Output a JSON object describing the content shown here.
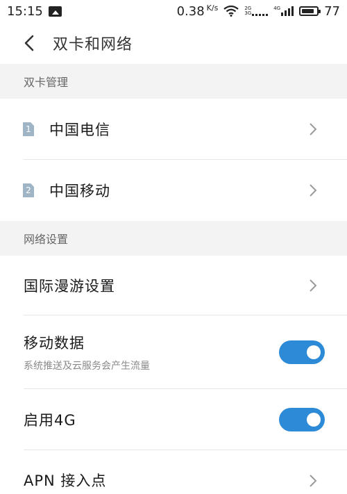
{
  "status": {
    "time": "15:15",
    "speed_value": "0.38",
    "speed_unit": "K/s",
    "sig1_label_top": "2G",
    "sig1_label_bottom": "3G",
    "sig2_label": "4G",
    "battery": "77"
  },
  "header": {
    "title": "双卡和网络"
  },
  "sections": {
    "dual_sim": {
      "title": "双卡管理"
    },
    "network": {
      "title": "网络设置"
    }
  },
  "sim_cards": [
    {
      "number": "1",
      "label": "中国电信"
    },
    {
      "number": "2",
      "label": "中国移动"
    }
  ],
  "network_items": {
    "roaming": {
      "label": "国际漫游设置"
    },
    "mobile_data": {
      "label": "移动数据",
      "sub": "系统推送及云服务会产生流量",
      "enabled": true
    },
    "enable_4g": {
      "label": "启用4G",
      "enabled": true
    },
    "apn": {
      "label": "APN 接入点"
    }
  },
  "colors": {
    "accent": "#2d8ad6",
    "sim_badge": "#9fb4c4",
    "section_bg": "#f3f3f3"
  }
}
